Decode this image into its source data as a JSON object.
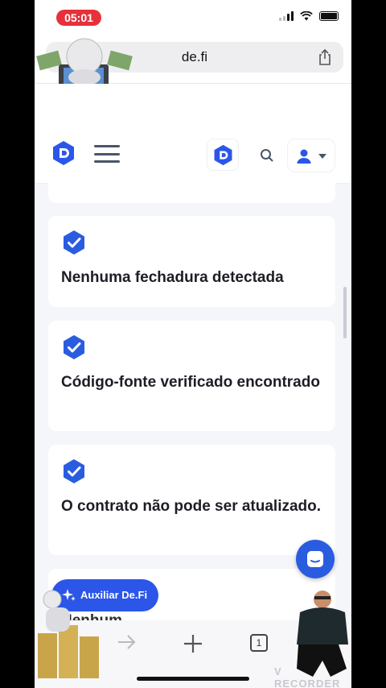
{
  "status_bar": {
    "time": "05:01"
  },
  "browser": {
    "url": "de.fi",
    "tab_count": "1"
  },
  "cards": [
    {
      "title": "Nenhuma fechadura detectada"
    },
    {
      "title": "Código-fonte verificado encontrado"
    },
    {
      "title": "O contrato não pode ser atualizado."
    }
  ],
  "assist_button": {
    "label": "Auxiliar De.Fi"
  },
  "partial_text": "Nenhum ...",
  "watermark": "V RECORDER",
  "colors": {
    "brand": "#2b56e8",
    "check": "#2a5ce0",
    "recording": "#e6313a"
  }
}
